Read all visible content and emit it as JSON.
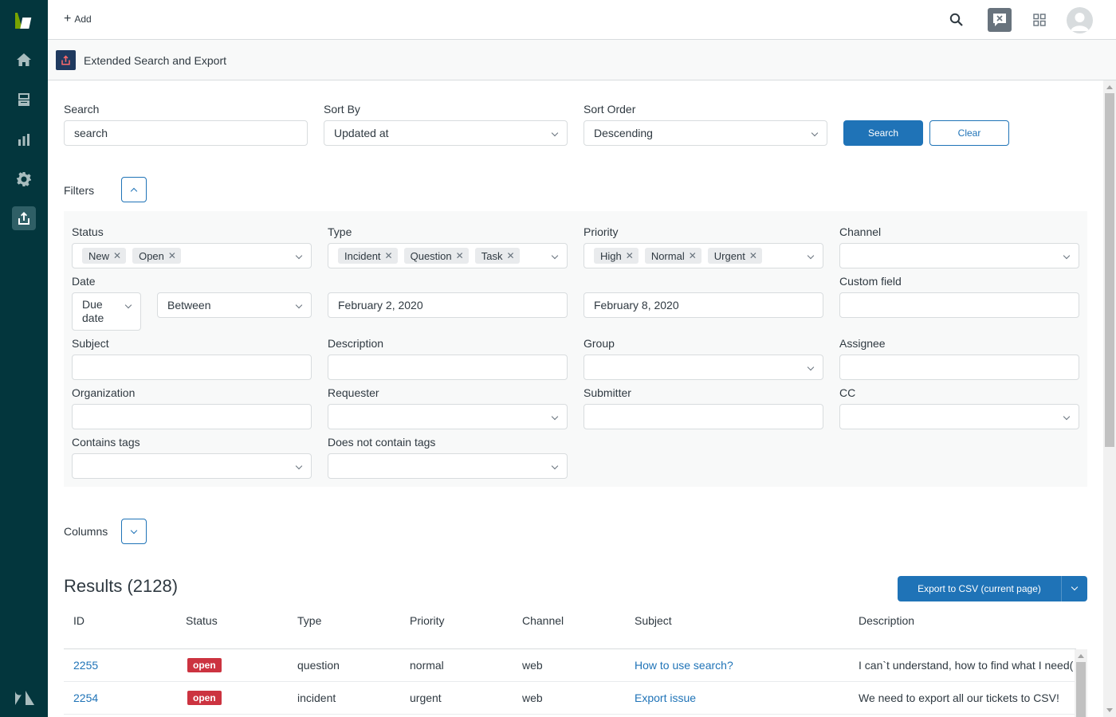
{
  "topbar": {
    "add_label": "Add"
  },
  "app": {
    "title": "Extended Search and Export"
  },
  "search": {
    "search_label": "Search",
    "search_value": "search",
    "sort_by_label": "Sort By",
    "sort_by_value": "Updated at",
    "sort_order_label": "Sort Order",
    "sort_order_value": "Descending",
    "search_button": "Search",
    "clear_button": "Clear"
  },
  "filters": {
    "title": "Filters",
    "status_label": "Status",
    "status_tags": [
      "New",
      "Open"
    ],
    "type_label": "Type",
    "type_tags": [
      "Incident",
      "Question",
      "Task"
    ],
    "priority_label": "Priority",
    "priority_tags": [
      "High",
      "Normal",
      "Urgent"
    ],
    "channel_label": "Channel",
    "date_label": "Date",
    "date_field": "Due date",
    "date_operator": "Between",
    "date_from": "February 2, 2020",
    "date_to": "February 8, 2020",
    "custom_field_label": "Custom field",
    "subject_label": "Subject",
    "description_label": "Description",
    "group_label": "Group",
    "assignee_label": "Assignee",
    "organization_label": "Organization",
    "requester_label": "Requester",
    "submitter_label": "Submitter",
    "cc_label": "CC",
    "contains_tags_label": "Contains tags",
    "not_contains_tags_label": "Does not contain tags"
  },
  "columns": {
    "title": "Columns"
  },
  "results": {
    "title": "Results (2128)",
    "export_button": "Export to CSV (current page)",
    "headers": [
      "ID",
      "Status",
      "Type",
      "Priority",
      "Channel",
      "Subject",
      "Description"
    ],
    "rows": [
      {
        "id": "2255",
        "status": "open",
        "type": "question",
        "priority": "normal",
        "channel": "web",
        "subject": "How to use search?",
        "description": "I can`t understand, how to find what I need("
      },
      {
        "id": "2254",
        "status": "open",
        "type": "incident",
        "priority": "urgent",
        "channel": "web",
        "subject": "Export issue",
        "description": "We need to export all our tickets to CSV!"
      }
    ]
  },
  "colors": {
    "sidebar": "#03363d",
    "primary": "#1f73b7",
    "badge_open": "#cc3340"
  }
}
